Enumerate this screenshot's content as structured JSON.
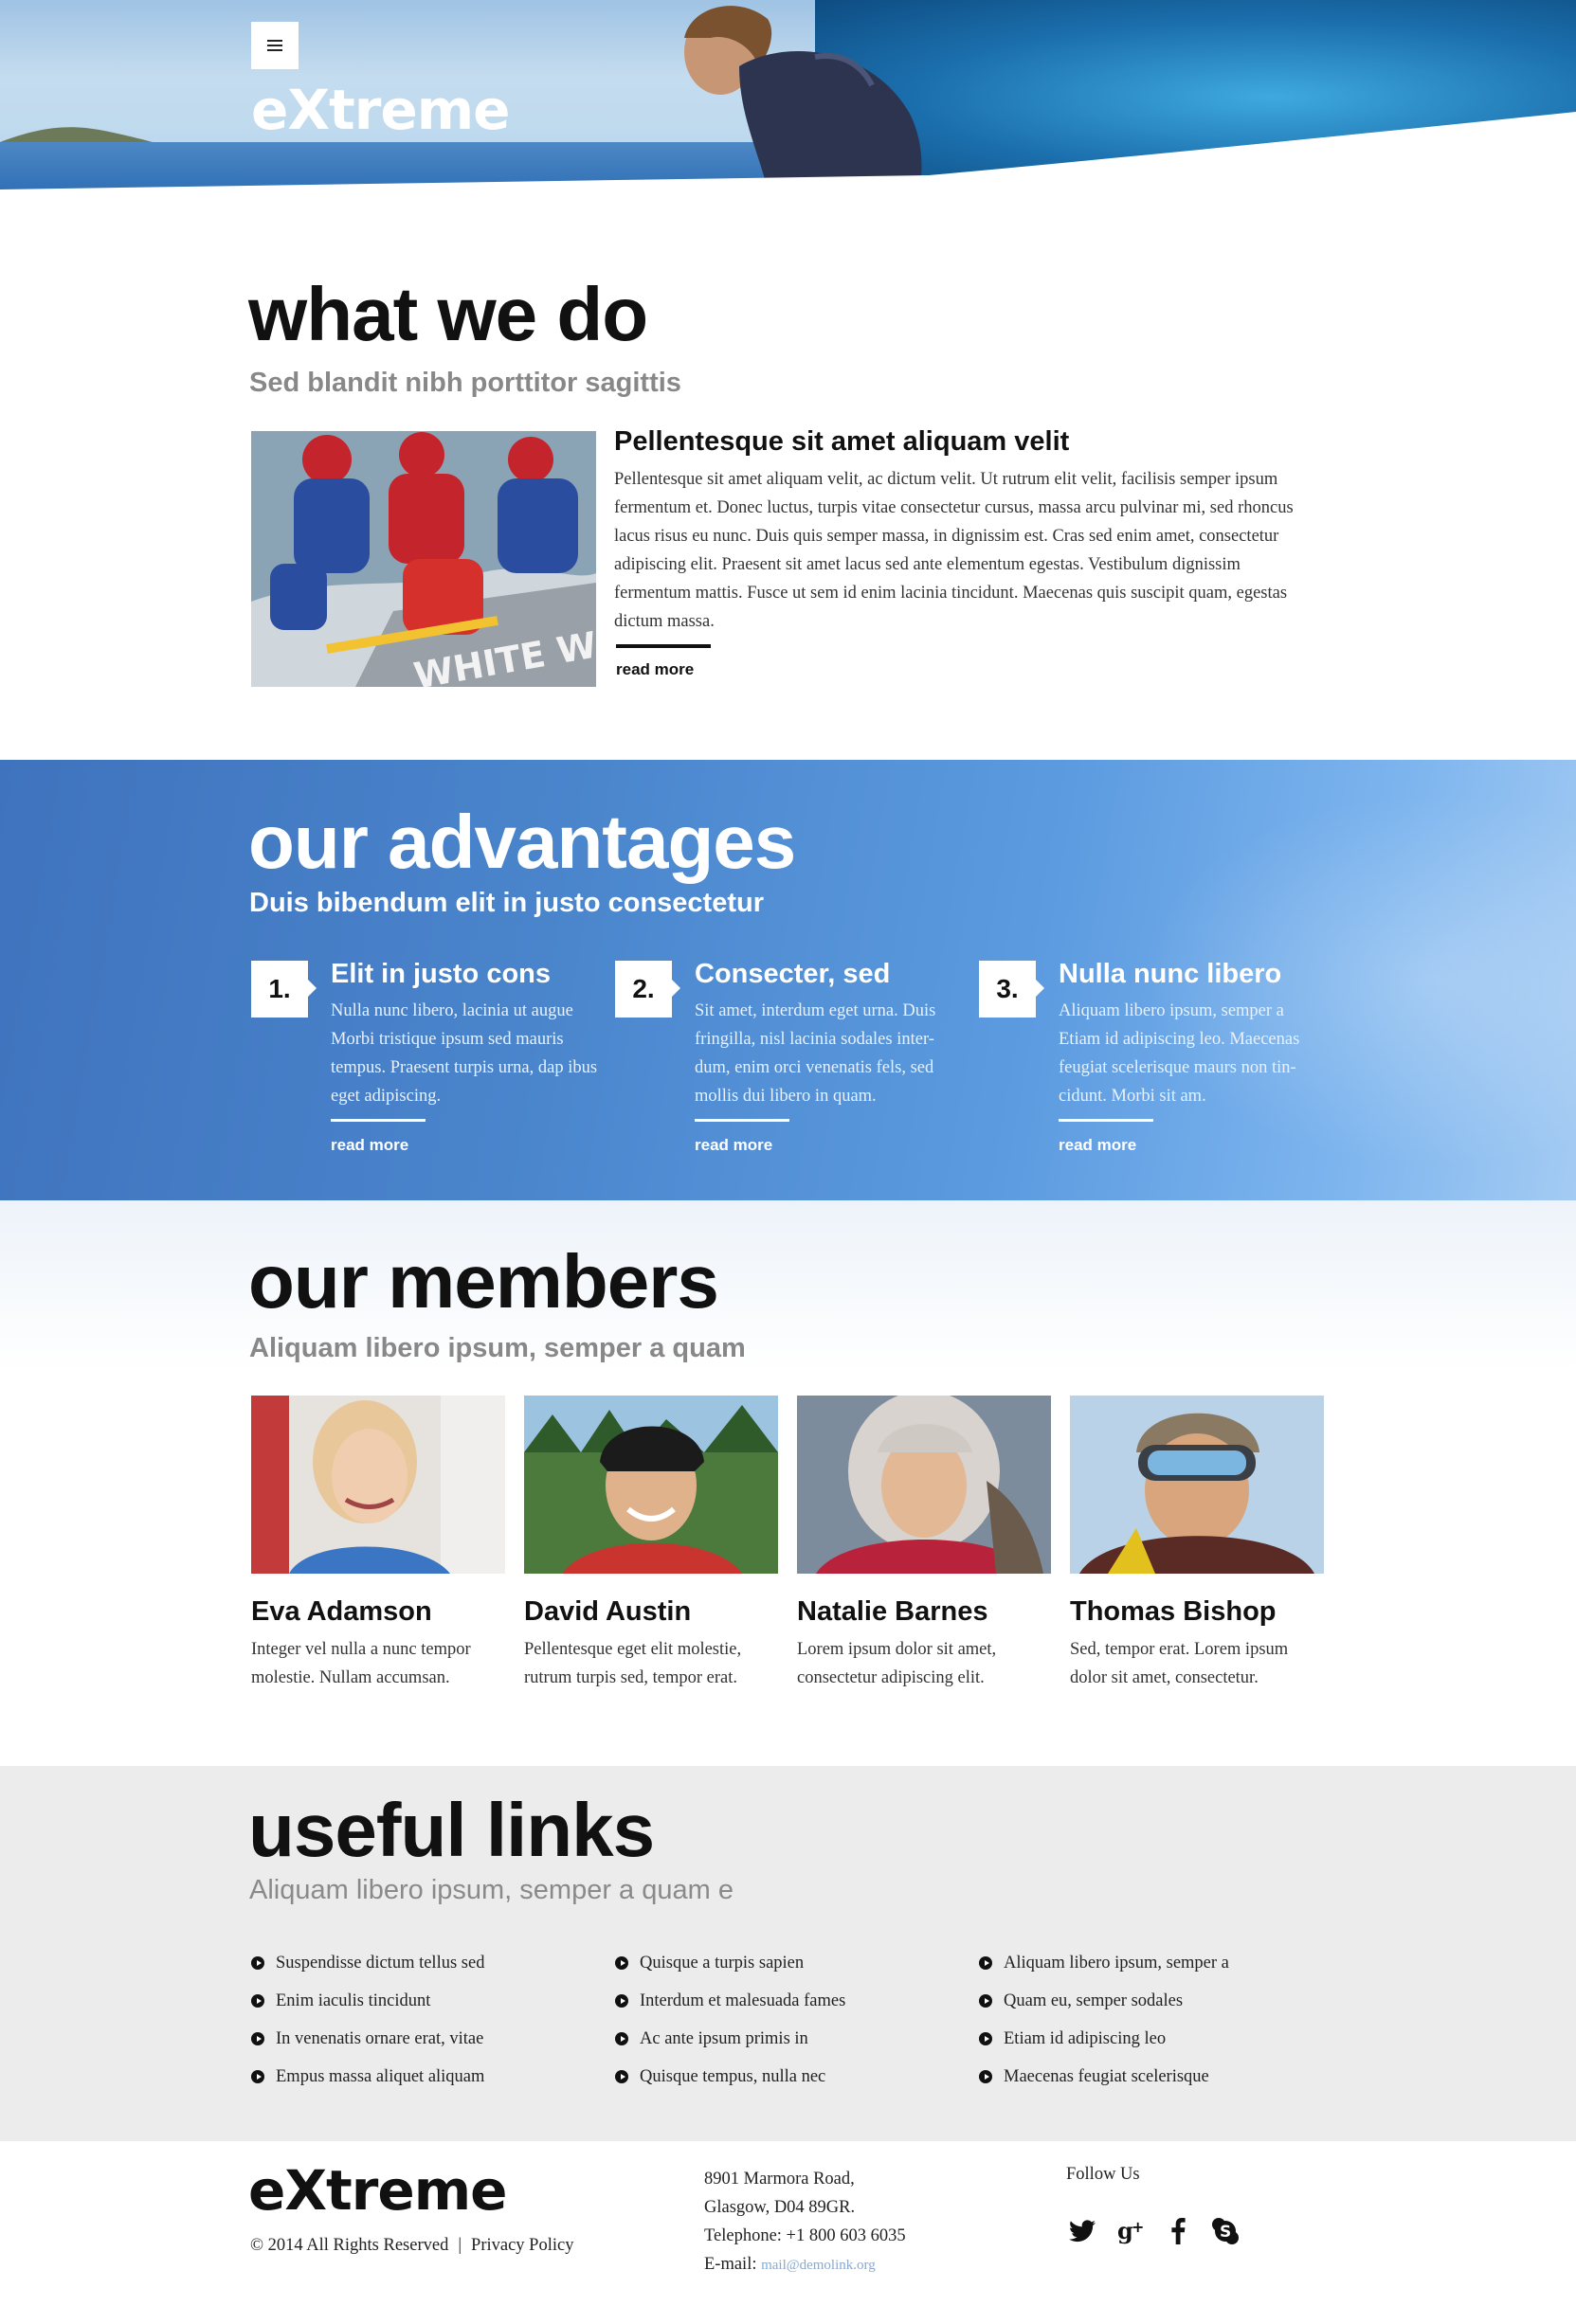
{
  "header": {
    "logo": "eXtreme",
    "menu_icon": "hamburger-icon"
  },
  "what_we_do": {
    "title": "what we do",
    "subtitle": "Sed blandit nibh porttitor sagittis",
    "heading": "Pellentesque sit amet aliquam velit",
    "text": "Pellentesque sit amet aliquam velit, ac dictum velit. Ut rutrum elit velit, facilisis semper ipsum fermentum et. Donec luctus, turpis vitae consectetur cursus, massa arcu pulvinar mi, sed rhoncus lacus risus eu nunc. Duis quis semper massa, in dignissim est. Cras sed enim amet, consectetur adipiscing elit. Praesent sit amet lacus sed ante elementum egestas. Vestibulum dignissim fermentum mattis. Fusce ut sem id enim lacinia tincidunt. Maecenas quis suscipit quam, egestas dictum massa.",
    "read_more": "read more"
  },
  "advantages": {
    "title": "our advantages",
    "subtitle": "Duis bibendum elit in justo consectetur",
    "items": [
      {
        "num": "1.",
        "heading": "Elit in justo cons",
        "text": "Nulla nunc libero, lacinia ut augue Morbi tristique ipsum sed mauris tempus. Praesent turpis urna, dap ibus eget adipiscing.",
        "read_more": "read more"
      },
      {
        "num": "2.",
        "heading": "Consecter, sed",
        "text": "Sit amet, interdum eget urna. Duis fringilla, nisl lacinia sodales inter-dum, enim orci venenatis fels, sed mollis dui libero in quam.",
        "read_more": "read more"
      },
      {
        "num": "3.",
        "heading": "Nulla nunc libero",
        "text": "Aliquam libero ipsum, semper a Etiam id adipiscing leo. Maecenas feugiat scelerisque maurs non tin-cidunt. Morbi sit am.",
        "read_more": "read more"
      }
    ]
  },
  "members": {
    "title": "our members",
    "subtitle": "Aliquam libero ipsum, semper a quam",
    "items": [
      {
        "name": "Eva Adamson",
        "bio": "Integer vel nulla a nunc tempor molestie. Nullam accumsan."
      },
      {
        "name": "David Austin",
        "bio": "Pellentesque eget elit molestie, rutrum turpis sed, tempor erat."
      },
      {
        "name": "Natalie Barnes",
        "bio": "Lorem ipsum dolor sit amet, consectetur adipiscing elit."
      },
      {
        "name": "Thomas Bishop",
        "bio": "Sed, tempor erat. Lorem ipsum dolor sit amet, consectetur."
      }
    ]
  },
  "useful_links": {
    "title": "useful links",
    "subtitle": "Aliquam libero ipsum, semper a quam e",
    "columns": [
      [
        "Suspendisse dictum tellus sed",
        "Enim iaculis tincidunt",
        "In venenatis ornare erat, vitae",
        "Empus massa aliquet aliquam"
      ],
      [
        "Quisque a turpis sapien",
        "Interdum et malesuada fames",
        "Ac ante ipsum primis in",
        "Quisque tempus, nulla nec"
      ],
      [
        "Aliquam libero ipsum, semper a",
        "Quam eu, semper sodales",
        "Etiam id adipiscing leo",
        "Maecenas feugiat scelerisque"
      ]
    ]
  },
  "footer": {
    "logo": "eXtreme",
    "copyright": "© 2014 All Rights Reserved",
    "separator": "|",
    "privacy": "Privacy Policy",
    "address_line1": "8901 Marmora Road,",
    "address_line2": "Glasgow, D04 89GR.",
    "telephone": "Telephone:  +1 800 603 6035",
    "email_label": "E-mail: ",
    "email": "mail@demolink.org",
    "follow": "Follow Us",
    "social_icons": [
      "twitter-icon",
      "google-plus-icon",
      "facebook-icon",
      "skype-icon"
    ]
  },
  "colors": {
    "accent_blue": "#4a85cc",
    "links_bg": "#ececec",
    "email_link": "#8aa9cc"
  }
}
